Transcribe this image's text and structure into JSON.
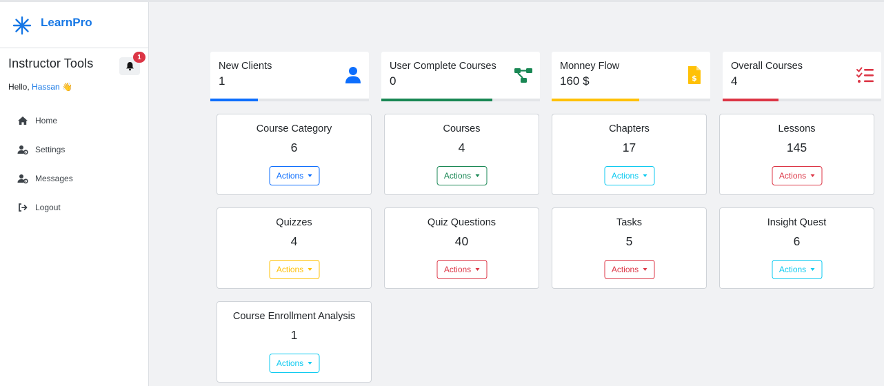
{
  "brand": {
    "name": "LearnPro"
  },
  "sidebar": {
    "title": "Instructor Tools",
    "greeting": "Hello,",
    "username": "Hassan",
    "wave": "👋",
    "notifications": "1",
    "nav": [
      {
        "label": "Home",
        "icon": "home-icon"
      },
      {
        "label": "Settings",
        "icon": "user-gear-icon"
      },
      {
        "label": "Messages",
        "icon": "user-gear-icon"
      },
      {
        "label": "Logout",
        "icon": "logout-icon"
      }
    ]
  },
  "stats": [
    {
      "label": "New Clients",
      "value": "1",
      "icon": "user-icon",
      "color": "#0d6efd",
      "progress": 0.3
    },
    {
      "label": "User Complete Courses",
      "value": "0",
      "icon": "diagram-icon",
      "color": "#198754",
      "progress": 0.7
    },
    {
      "label": "Monney Flow",
      "value": "160 $",
      "icon": "invoice-dollar-icon",
      "color": "#ffc107",
      "progress": 0.55
    },
    {
      "label": "Overall Courses",
      "value": "4",
      "icon": "list-check-icon",
      "color": "#dc3545",
      "progress": 0.35
    }
  ],
  "cards": [
    {
      "title": "Course Category",
      "count": "6",
      "action": "Actions",
      "color": "#0d6efd"
    },
    {
      "title": "Courses",
      "count": "4",
      "action": "Actions",
      "color": "#198754"
    },
    {
      "title": "Chapters",
      "count": "17",
      "action": "Actions",
      "color": "#0dcaf0"
    },
    {
      "title": "Lessons",
      "count": "145",
      "action": "Actions",
      "color": "#dc3545"
    },
    {
      "title": "Quizzes",
      "count": "4",
      "action": "Actions",
      "color": "#ffc107"
    },
    {
      "title": "Quiz Questions",
      "count": "40",
      "action": "Actions",
      "color": "#dc3545"
    },
    {
      "title": "Tasks",
      "count": "5",
      "action": "Actions",
      "color": "#dc3545"
    },
    {
      "title": "Insight Quest",
      "count": "6",
      "action": "Actions",
      "color": "#0dcaf0"
    },
    {
      "title": "Course Enrollment Analysis",
      "count": "1",
      "action": "Actions",
      "color": "#0dcaf0"
    }
  ]
}
